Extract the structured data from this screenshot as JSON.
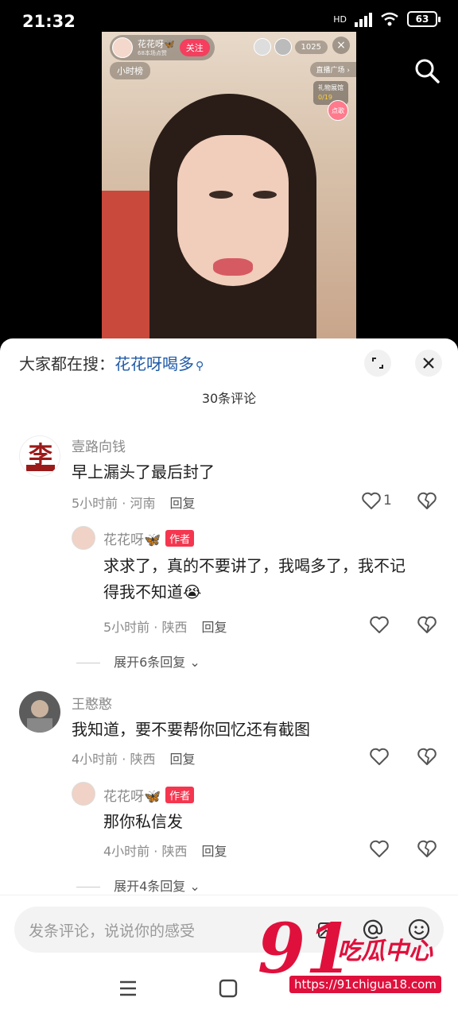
{
  "status_bar": {
    "time": "21:32",
    "network": "HD",
    "battery": "63"
  },
  "live": {
    "streamer": "花花呀🦋",
    "streamer_sub": "68本场点赞",
    "follow": "关注",
    "viewers": "1025",
    "close": "×",
    "hour_rank": "小时榜",
    "plaza": "直播广场 ›",
    "gift_label": "礼物展馆",
    "gift_count": "0/19",
    "sing": "点歌"
  },
  "sheet": {
    "hot_label": "大家都在搜：",
    "hot_keyword": "花花呀喝多",
    "comment_count": "30条评论"
  },
  "comments": [
    {
      "user": "壹路向钱",
      "text": "早上漏头了最后封了",
      "time": "5小时前 · 河南",
      "reply": "回复",
      "likes": "1",
      "reply_item": {
        "user": "花花呀🦋",
        "tag": "作者",
        "text_line1": "求求了，真的不要讲了，我喝多了，我不记",
        "text_line2": "得我不知道😭",
        "time": "5小时前 · 陕西",
        "reply": "回复"
      },
      "expand": "展开6条回复"
    },
    {
      "user": "王憨憨",
      "text": "我知道，要不要帮你回忆还有截图",
      "time": "4小时前 · 陕西",
      "reply": "回复",
      "reply_item": {
        "user": "花花呀🦋",
        "tag": "作者",
        "text_line1": "那你私信发",
        "time": "4小时前 · 陕西",
        "reply": "回复"
      },
      "expand": "展开4条回复"
    }
  ],
  "input": {
    "placeholder": "发条评论，说说你的感受"
  },
  "watermark": {
    "number": "91",
    "brand": "吃瓜中心",
    "url": "https://91chigua18.com"
  }
}
